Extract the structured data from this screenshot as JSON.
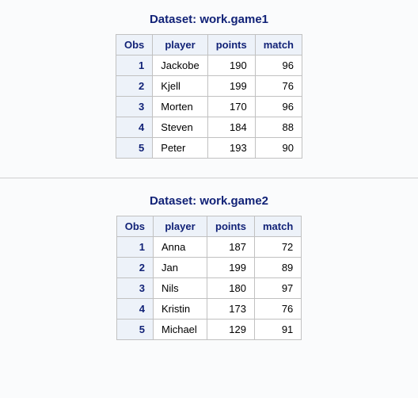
{
  "tables": [
    {
      "title": "Dataset: work.game1",
      "columns": [
        "Obs",
        "player",
        "points",
        "match"
      ],
      "rows": [
        {
          "obs": "1",
          "player": "Jackobe",
          "points": "190",
          "match": "96"
        },
        {
          "obs": "2",
          "player": "Kjell",
          "points": "199",
          "match": "76"
        },
        {
          "obs": "3",
          "player": "Morten",
          "points": "170",
          "match": "96"
        },
        {
          "obs": "4",
          "player": "Steven",
          "points": "184",
          "match": "88"
        },
        {
          "obs": "5",
          "player": "Peter",
          "points": "193",
          "match": "90"
        }
      ]
    },
    {
      "title": "Dataset: work.game2",
      "columns": [
        "Obs",
        "player",
        "points",
        "match"
      ],
      "rows": [
        {
          "obs": "1",
          "player": "Anna",
          "points": "187",
          "match": "72"
        },
        {
          "obs": "2",
          "player": "Jan",
          "points": "199",
          "match": "89"
        },
        {
          "obs": "3",
          "player": "Nils",
          "points": "180",
          "match": "97"
        },
        {
          "obs": "4",
          "player": "Kristin",
          "points": "173",
          "match": "76"
        },
        {
          "obs": "5",
          "player": "Michael",
          "points": "129",
          "match": "91"
        }
      ]
    }
  ]
}
